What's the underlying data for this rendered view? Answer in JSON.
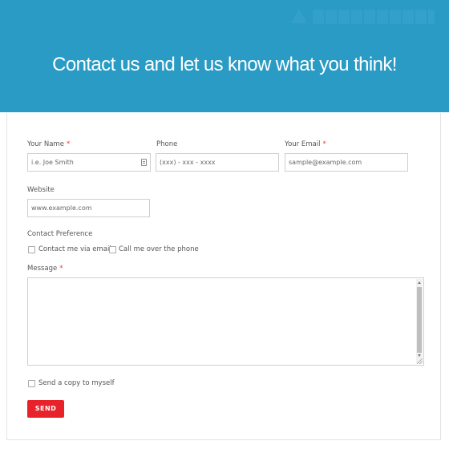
{
  "header": {
    "title": "Contact us and let us know what you think!",
    "background_color": "#2a9bc4"
  },
  "form": {
    "name": {
      "label": "Your Name",
      "required_mark": "*",
      "placeholder": "i.e. Joe Smith"
    },
    "phone": {
      "label": "Phone",
      "placeholder": "(xxx) - xxx - xxxx"
    },
    "email": {
      "label": "Your Email",
      "required_mark": "*",
      "placeholder": "sample@example.com"
    },
    "website": {
      "label": "Website",
      "placeholder": "www.example.com"
    },
    "contact_preference": {
      "label": "Contact Preference",
      "options": [
        {
          "label": "Contact me via email",
          "checked": false
        },
        {
          "label": "Call me over the phone",
          "checked": false
        }
      ]
    },
    "message": {
      "label": "Message",
      "required_mark": "*",
      "value": ""
    },
    "copy_option": {
      "label": "Send a copy to myself",
      "checked": false
    },
    "send_label": "SEND",
    "send_color": "#e8222b",
    "required_color": "#e53935"
  },
  "icons": {
    "name_field_icon": "contact-card-icon",
    "logo": "site-logo"
  }
}
